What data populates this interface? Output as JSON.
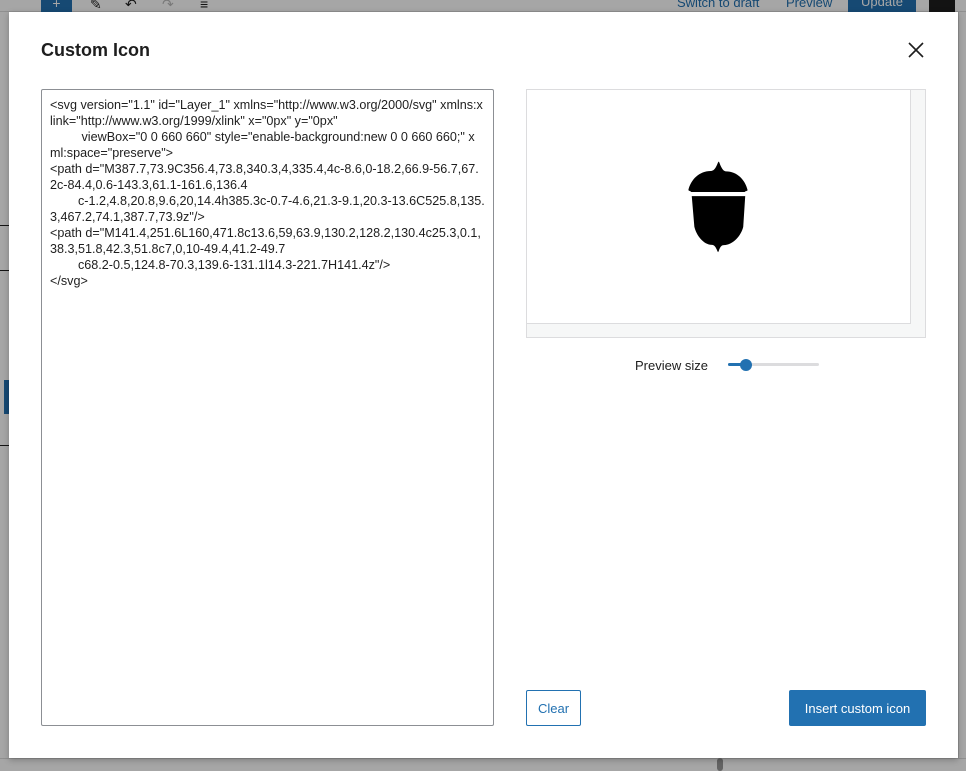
{
  "background": {
    "add_label": "+",
    "switch_to_draft": "Switch to draft",
    "preview": "Preview",
    "update": "Update"
  },
  "modal": {
    "title": "Custom Icon",
    "svg_code": "<svg version=\"1.1\" id=\"Layer_1\" xmlns=\"http://www.w3.org/2000/svg\" xmlns:xlink=\"http://www.w3.org/1999/xlink\" x=\"0px\" y=\"0px\"\n\t viewBox=\"0 0 660 660\" style=\"enable-background:new 0 0 660 660;\" xml:space=\"preserve\">\n<path d=\"M387.7,73.9C356.4,73.8,340.3,4,335.4,4c-8.6,0-18.2,66.9-56.7,67.2c-84.4,0.6-143.3,61.1-161.6,136.4\n\tc-1.2,4.8,20.8,9.6,20,14.4h385.3c-0.7-4.6,21.3-9.1,20.3-13.6C525.8,135.3,467.2,74.1,387.7,73.9z\"/>\n<path d=\"M141.4,251.6L160,471.8c13.6,59,63.9,130.2,128.2,130.4c25.3,0.1,38.3,51.8,42.3,51.8c7,0,10-49.4,41.2-49.7\n\tc68.2-0.5,124.8-70.3,139.6-131.1l14.3-221.7H141.4z\"/>\n</svg>",
    "preview_icon": "acorn-icon",
    "preview_size_label": "Preview size",
    "preview_size_value": 0.2,
    "clear_label": "Clear",
    "insert_label": "Insert custom icon"
  },
  "colors": {
    "accent": "#2271b1",
    "text": "#1e1e1e",
    "border": "#8c8f94"
  }
}
